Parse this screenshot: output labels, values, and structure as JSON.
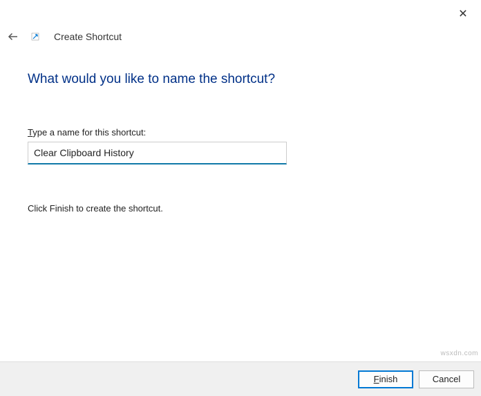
{
  "window": {
    "title": "Create Shortcut"
  },
  "main": {
    "heading": "What would you like to name the shortcut?",
    "name_label_prefix": "T",
    "name_label_rest": "ype a name for this shortcut:",
    "name_value": "Clear Clipboard History",
    "instruction": "Click Finish to create the shortcut."
  },
  "footer": {
    "finish_prefix": "F",
    "finish_rest": "inish",
    "cancel_label": "Cancel"
  },
  "watermark": "wsxdn.com"
}
